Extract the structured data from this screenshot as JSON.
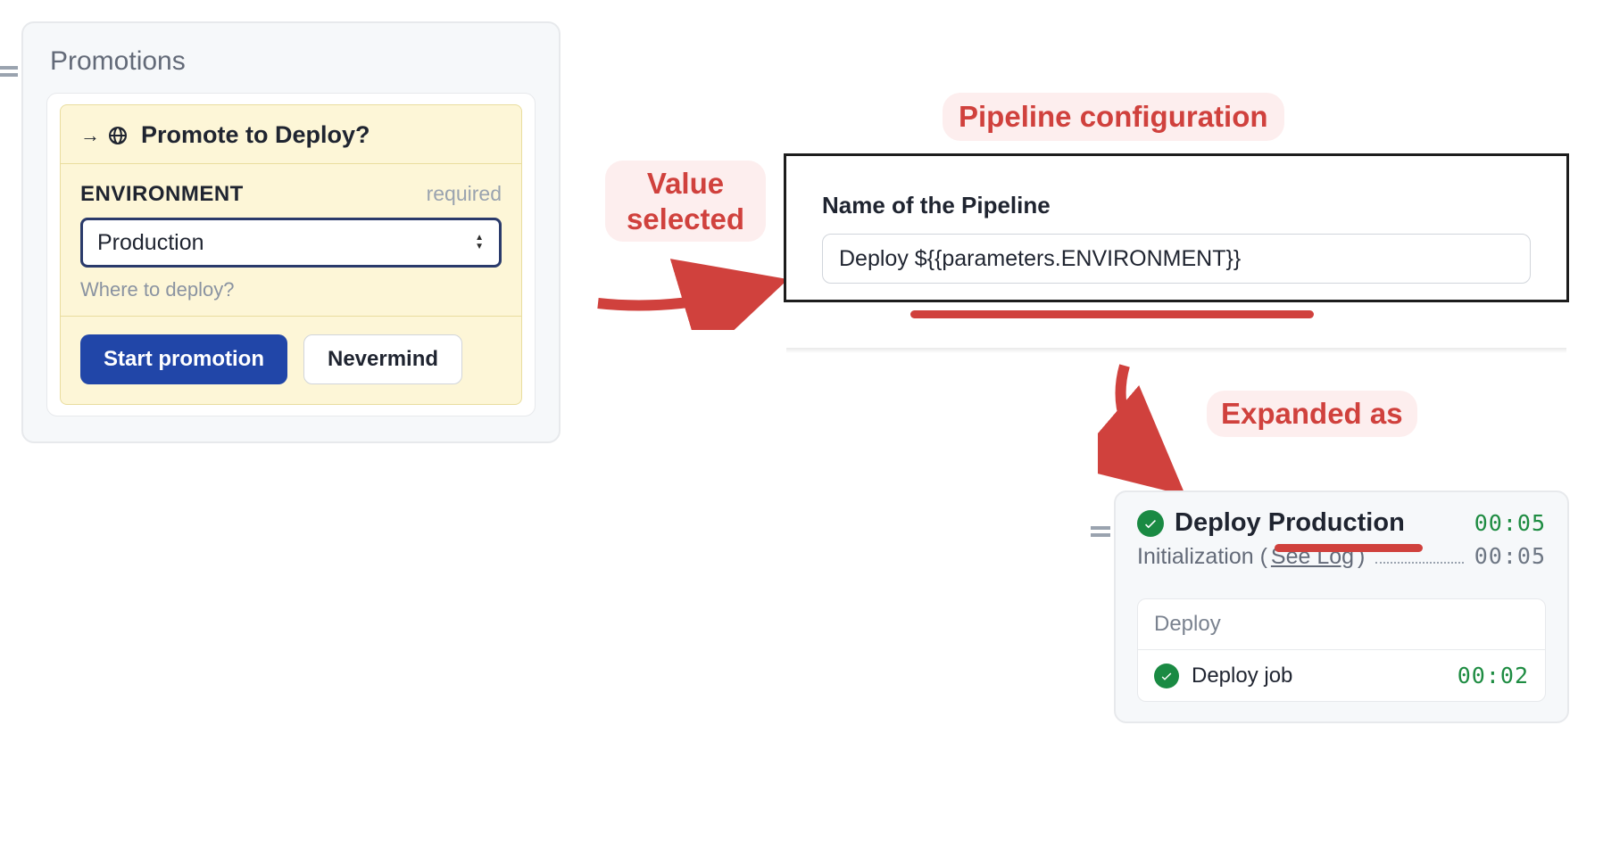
{
  "promotions": {
    "panel_title": "Promotions",
    "prompt_title": "Promote to Deploy?",
    "field": {
      "label": "ENVIRONMENT",
      "required_text": "required",
      "selected_value": "Production",
      "help": "Where to deploy?"
    },
    "actions": {
      "primary": "Start promotion",
      "secondary": "Nevermind"
    }
  },
  "annotations": {
    "value_selected": "Value selected",
    "pipeline_config": "Pipeline configuration",
    "expanded_as": "Expanded  as"
  },
  "config": {
    "label": "Name of the Pipeline",
    "value": "Deploy ${{parameters.ENVIRONMENT}}"
  },
  "result": {
    "title": "Deploy Production",
    "title_time": "00:05",
    "init_label_prefix": "Initialization (",
    "init_see_log": "See Log",
    "init_label_suffix": ")",
    "init_time": "00:05",
    "block_name": "Deploy",
    "job_name": "Deploy job",
    "job_time": "00:02"
  },
  "colors": {
    "accent_red": "#d0413d",
    "primary_blue": "#2146a8",
    "success_green": "#1a8a43"
  }
}
